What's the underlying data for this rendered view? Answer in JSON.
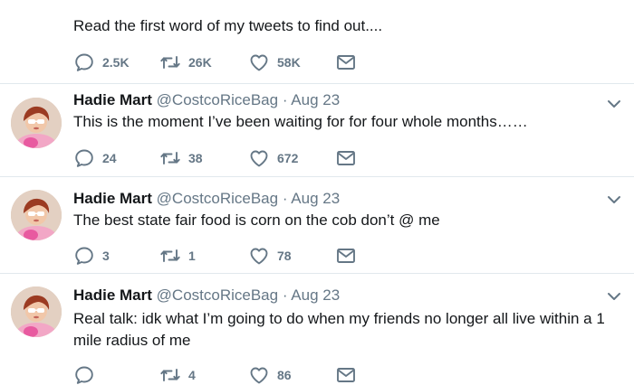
{
  "top_tweet": {
    "text": "Read the first word of my tweets to find out....",
    "replies": "2.5K",
    "retweets": "26K",
    "likes": "58K"
  },
  "tweets": [
    {
      "name": "Hadie Mart",
      "handle": "@CostcoRiceBag",
      "separator": "·",
      "date": "Aug 23",
      "first_word": "This",
      "rest": " is the moment I’ve been waiting for for four whole months……",
      "replies": "24",
      "retweets": "38",
      "likes": "672"
    },
    {
      "name": "Hadie Mart",
      "handle": "@CostcoRiceBag",
      "separator": "·",
      "date": "Aug 23",
      "first_word": "The",
      "rest": " best state fair food is corn on the cob don’t @ me",
      "replies": "3",
      "retweets": "1",
      "likes": "78"
    },
    {
      "name": "Hadie Mart",
      "handle": "@CostcoRiceBag",
      "separator": "·",
      "date": "Aug 23",
      "first_word": "Real",
      "rest": " talk: idk what I’m going to do when my friends no longer all live within a 1 mile radius of me",
      "replies": "",
      "retweets": "4",
      "likes": "86"
    }
  ],
  "colors": {
    "highlight": "#c8f31e",
    "text": "#14171a",
    "muted": "#657786",
    "divider": "#e1e8ed"
  },
  "icons": [
    "reply-icon",
    "retweet-icon",
    "like-icon",
    "message-icon",
    "chevron-down-icon"
  ]
}
